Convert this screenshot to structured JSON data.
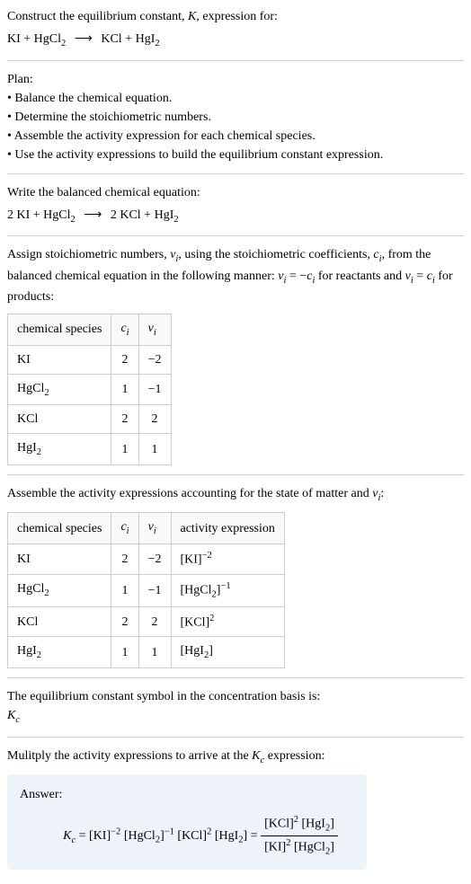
{
  "header": {
    "construct": "Construct the equilibrium constant, K, expression for:",
    "eq": "KI + HgCl₂ ⟶ KCl + HgI₂"
  },
  "plan": {
    "title": "Plan:",
    "b1": "• Balance the chemical equation.",
    "b2": "• Determine the stoichiometric numbers.",
    "b3": "• Assemble the activity expression for each chemical species.",
    "b4": "• Use the activity expressions to build the equilibrium constant expression."
  },
  "balanced": {
    "title": "Write the balanced chemical equation:",
    "eq": "2 KI + HgCl₂ ⟶ 2 KCl + HgI₂"
  },
  "stoich": {
    "intro": "Assign stoichiometric numbers, νᵢ, using the stoichiometric coefficients, cᵢ, from the balanced chemical equation in the following manner: νᵢ = −cᵢ for reactants and νᵢ = cᵢ for products:",
    "headers": {
      "sp": "chemical species",
      "ci": "cᵢ",
      "vi": "νᵢ"
    },
    "rows": [
      {
        "sp": "KI",
        "ci": "2",
        "vi": "−2"
      },
      {
        "sp": "HgCl₂",
        "ci": "1",
        "vi": "−1"
      },
      {
        "sp": "KCl",
        "ci": "2",
        "vi": "2"
      },
      {
        "sp": "HgI₂",
        "ci": "1",
        "vi": "1"
      }
    ]
  },
  "activity": {
    "intro": "Assemble the activity expressions accounting for the state of matter and νᵢ:",
    "headers": {
      "sp": "chemical species",
      "ci": "cᵢ",
      "vi": "νᵢ",
      "ae": "activity expression"
    },
    "rows": [
      {
        "sp": "KI",
        "ci": "2",
        "vi": "−2",
        "ae": "[KI]⁻²"
      },
      {
        "sp": "HgCl₂",
        "ci": "1",
        "vi": "−1",
        "ae": "[HgCl₂]⁻¹"
      },
      {
        "sp": "KCl",
        "ci": "2",
        "vi": "2",
        "ae": "[KCl]²"
      },
      {
        "sp": "HgI₂",
        "ci": "1",
        "vi": "1",
        "ae": "[HgI₂]"
      }
    ]
  },
  "basis": {
    "line1": "The equilibrium constant symbol in the concentration basis is:",
    "line2": "K_c"
  },
  "multiply": {
    "intro": "Mulitply the activity expressions to arrive at the K_c expression:"
  },
  "answer": {
    "label": "Answer:",
    "lhs": "K_c = [KI]⁻² [HgCl₂]⁻¹ [KCl]² [HgI₂] =",
    "num": "[KCl]² [HgI₂]",
    "den": "[KI]² [HgCl₂]"
  }
}
